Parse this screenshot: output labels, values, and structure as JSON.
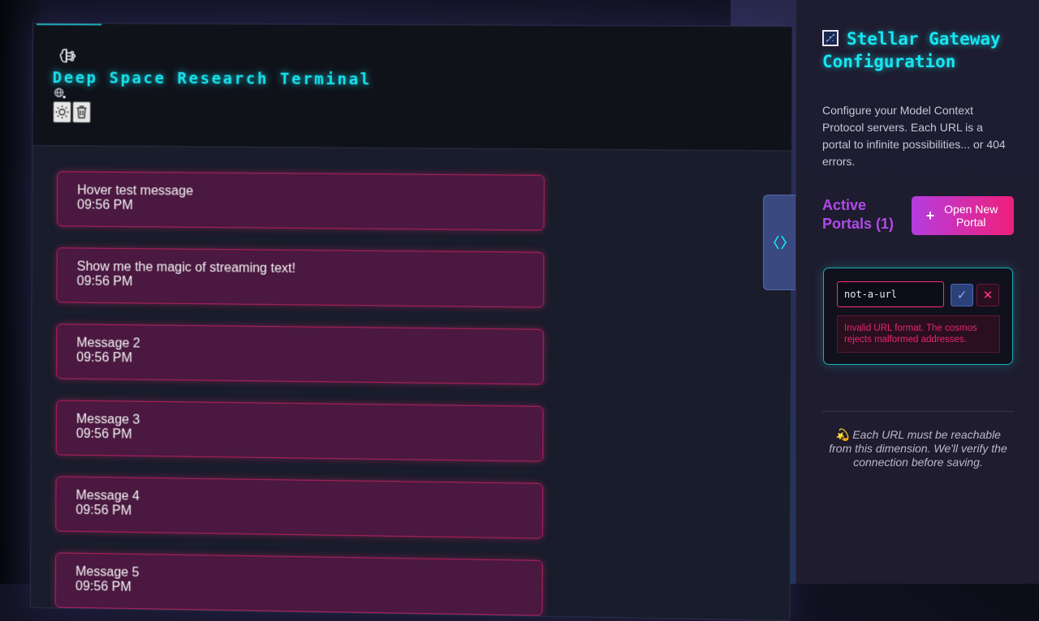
{
  "terminal": {
    "title": "Deep Space Research Terminal"
  },
  "messages": [
    {
      "text": "Hover test message",
      "time": "09:56 PM"
    },
    {
      "text": "Show me the magic of streaming text!",
      "time": "09:56 PM"
    },
    {
      "text": "Message 2",
      "time": "09:56 PM"
    },
    {
      "text": "Message 3",
      "time": "09:56 PM"
    },
    {
      "text": "Message 4",
      "time": "09:56 PM"
    },
    {
      "text": "Message 5",
      "time": "09:56 PM"
    }
  ],
  "sidebar": {
    "title": "Stellar Gateway Configuration",
    "description": "Configure your Model Context Protocol servers. Each URL is a portal to infinite possibilities... or 404 errors.",
    "active_portals_label": "Active Portals (1)",
    "open_portal_label": "Open New Portal",
    "open_portal_plus": "+",
    "portal": {
      "url_value": "not-a-url",
      "confirm_symbol": "✓",
      "cancel_symbol": "✕",
      "error": "Invalid URL format. The cosmos rejects malformed addresses."
    },
    "note_emoji": "💫",
    "note": "Each URL must be reachable from this dimension. We'll verify the connection before saving."
  },
  "colors": {
    "accent_cyan": "#17e6f2",
    "message_bg": "#4a1840",
    "message_border": "#b8205e",
    "portal_gradient_start": "#b53ce0",
    "portal_gradient_end": "#f0207a",
    "error_text": "#e8246e"
  },
  "icons": {
    "header": "brain-icon",
    "status": "network-status-icon",
    "theme": "sun-icon",
    "clear": "trash-icon",
    "collapse": "collapse-chevrons-icon",
    "sidebar_title": "stars-image-icon"
  }
}
